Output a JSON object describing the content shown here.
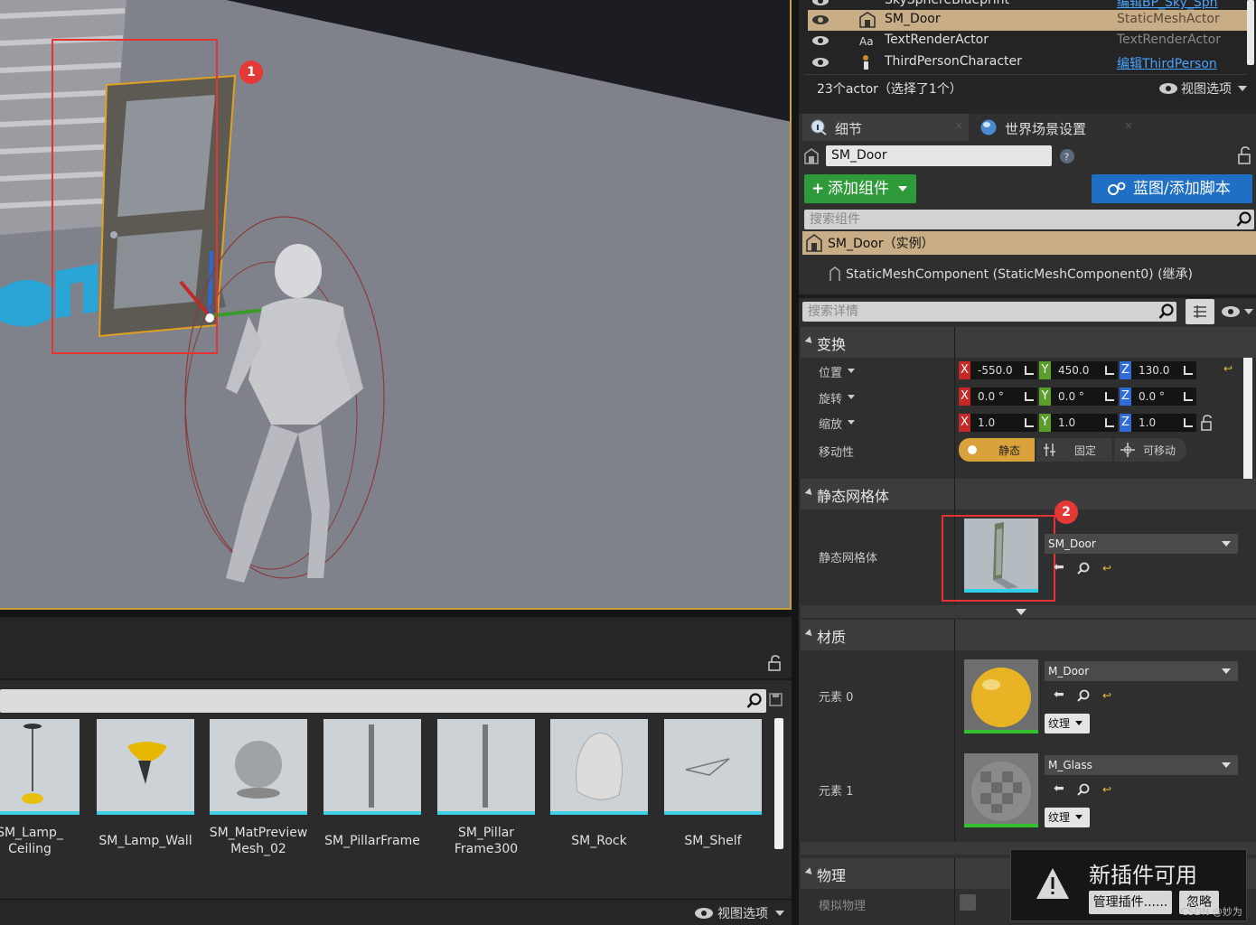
{
  "viewport": {
    "badge1": "1",
    "badge2": "2"
  },
  "outliner": {
    "rows": [
      {
        "name": "SkySphereBlueprint",
        "type": "编辑BP_Sky_Sph",
        "type_link": true,
        "selected": false
      },
      {
        "name": "SM_Door",
        "type": "StaticMeshActor",
        "type_link": false,
        "selected": true
      },
      {
        "name": "TextRenderActor",
        "type": "TextRenderActor",
        "type_link": false,
        "selected": false
      },
      {
        "name": "ThirdPersonCharacter",
        "type": "编辑ThirdPerson",
        "type_link": true,
        "selected": false
      }
    ],
    "summary": "23个actor（选择了1个）",
    "view_options": "视图选项"
  },
  "details": {
    "tabs": [
      {
        "label": "细节"
      },
      {
        "label": "世界场景设置"
      }
    ],
    "actor_name": "SM_Door",
    "add_component": "添加组件",
    "blueprint_button": "蓝图/添加脚本",
    "search_components_placeholder": "搜索组件",
    "instance_row": "SM_Door（实例）",
    "component_row": "StaticMeshComponent (StaticMeshComponent0) (继承)",
    "search_details_placeholder": "搜索详情",
    "transform": {
      "title": "变换",
      "location_label": "位置",
      "rotation_label": "旋转",
      "scale_label": "缩放",
      "mobility_label": "移动性",
      "location": {
        "x": "-550.0",
        "y": "450.0",
        "z": "130.0"
      },
      "rotation": {
        "x": "0.0 °",
        "y": "0.0 °",
        "z": "0.0 °"
      },
      "scale": {
        "x": "1.0",
        "y": "1.0",
        "z": "1.0"
      },
      "axis_x": "X",
      "axis_y": "Y",
      "axis_z": "Z",
      "mobility": {
        "static": "静态",
        "stationary": "固定",
        "movable": "可移动"
      }
    },
    "static_mesh": {
      "title": "静态网格体",
      "label": "静态网格体",
      "value": "SM_Door"
    },
    "materials": {
      "title": "材质",
      "elements": [
        {
          "label": "元素 0",
          "value": "M_Door",
          "texture": "纹理"
        },
        {
          "label": "元素 1",
          "value": "M_Glass",
          "texture": "纹理"
        }
      ]
    },
    "physics": {
      "title": "物理",
      "simulate": "模拟物理"
    }
  },
  "content_browser": {
    "items": [
      {
        "line1": "SM_Lamp_",
        "line2": "Ceiling"
      },
      {
        "line1": "SM_Lamp_Wall",
        "line2": ""
      },
      {
        "line1": "SM_MatPreview",
        "line2": "Mesh_02"
      },
      {
        "line1": "SM_PillarFrame",
        "line2": ""
      },
      {
        "line1": "SM_Pillar",
        "line2": "Frame300"
      },
      {
        "line1": "SM_Rock",
        "line2": ""
      },
      {
        "line1": "SM_Shelf",
        "line2": ""
      }
    ],
    "view_options": "视图选项"
  },
  "notification": {
    "title": "新插件可用",
    "manage": "管理插件......",
    "ignore": "忽略",
    "watermark": "CSDN @妙为"
  }
}
